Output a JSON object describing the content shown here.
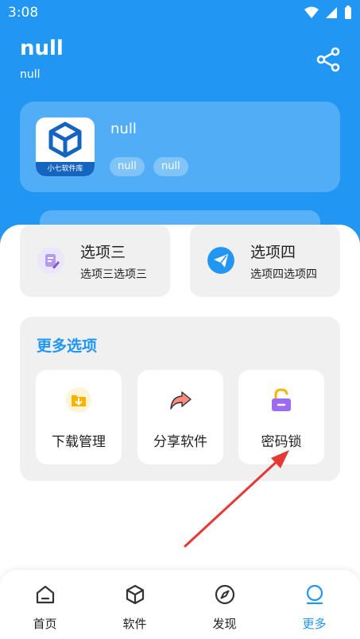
{
  "status_bar": {
    "time": "3:08"
  },
  "header": {
    "title": "null",
    "subtitle": "null"
  },
  "app_card": {
    "name": "null",
    "icon_caption": "小七软件库",
    "tags": [
      "null",
      "null"
    ]
  },
  "options": [
    {
      "title": "选项三",
      "desc": "选项三选项三",
      "icon": "edit-icon",
      "color": "#b59af0"
    },
    {
      "title": "选项四",
      "desc": "选项四选项四",
      "icon": "send-icon",
      "color": "#2196f3"
    }
  ],
  "more": {
    "title": "更多选项",
    "items": [
      {
        "label": "下载管理",
        "icon": "download-folder-icon",
        "color": "#f4b400"
      },
      {
        "label": "分享软件",
        "icon": "share-arrow-icon",
        "color": "#ff8a80"
      },
      {
        "label": "密码锁",
        "icon": "lock-icon",
        "color": "#9c6bf0"
      }
    ]
  },
  "bottom_nav": {
    "items": [
      {
        "label": "首页",
        "icon": "home-icon"
      },
      {
        "label": "软件",
        "icon": "box-icon"
      },
      {
        "label": "发现",
        "icon": "compass-icon"
      },
      {
        "label": "更多",
        "icon": "person-icon"
      }
    ],
    "active_index": 3
  },
  "colors": {
    "primary": "#2196f3",
    "annotation_arrow": "#e53935"
  }
}
